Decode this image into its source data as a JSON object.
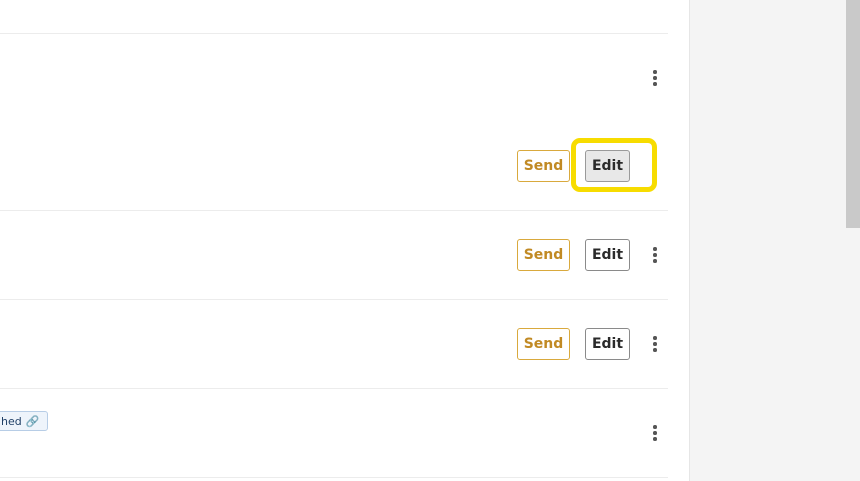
{
  "rows": [
    {
      "send_label": "Send",
      "edit_label": "Edit"
    },
    {
      "send_label": "Send",
      "edit_label": "Edit"
    },
    {
      "send_label": "Send",
      "edit_label": "Edit"
    }
  ],
  "tag": {
    "text": "hed",
    "icon": "link-icon"
  },
  "colors": {
    "send_accent": "#c18a24",
    "highlight": "#f7dc00",
    "tag_background": "#eef4fb"
  }
}
